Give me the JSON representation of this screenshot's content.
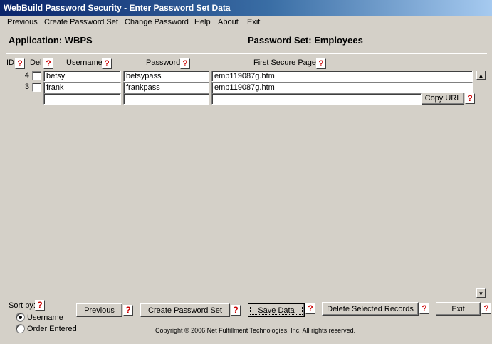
{
  "window": {
    "title": "WebBuild Password Security - Enter Password Set Data"
  },
  "menu": [
    "Previous",
    "Create Password Set",
    "Change Password",
    "Help",
    "About",
    "Exit"
  ],
  "header": {
    "application": "Application: WBPS",
    "password_set": "Password Set: Employees"
  },
  "columns": {
    "id": "ID",
    "del": "Del",
    "username": "Username",
    "password": "Password",
    "first_secure_page": "First Secure Page"
  },
  "help_glyph": "?",
  "rows": [
    {
      "id": "4",
      "username": "betsy",
      "password": "betsypass",
      "page": "emp119087g.htm"
    },
    {
      "id": "3",
      "username": "frank",
      "password": "frankpass",
      "page": "emp119087g.htm"
    }
  ],
  "new_row": {
    "username": "",
    "password": "",
    "page": ""
  },
  "copy_url_label": "Copy URL",
  "sort": {
    "label": "Sort by:",
    "options": [
      "Username",
      "Order Entered"
    ],
    "selected": "Username"
  },
  "buttons": {
    "previous": "Previous",
    "create": "Create Password Set",
    "save": "Save Data",
    "delete": "Delete Selected Records",
    "exit": "Exit"
  },
  "copyright": "Copyright © 2006 Net Fulfillment Technologies, Inc. All rights reserved."
}
